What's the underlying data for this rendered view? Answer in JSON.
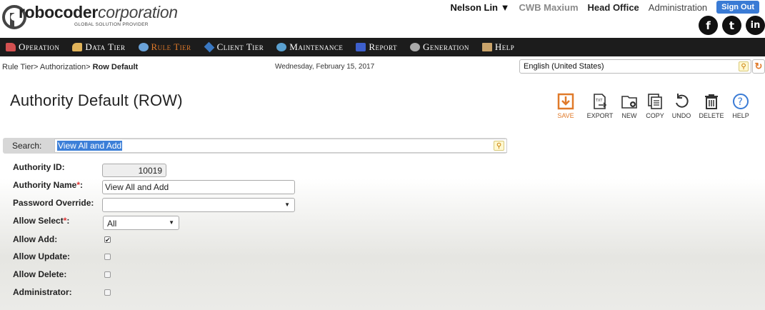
{
  "brand": {
    "name_bold": "robocoder",
    "name_italic": "corporation",
    "tagline": "GLOBAL SOLUTION PROVIDER"
  },
  "topnav": {
    "user": "Nelson Lin ▼",
    "company": "CWB Maxium",
    "office": "Head Office",
    "admin": "Administration",
    "signout": "Sign Out"
  },
  "social": {
    "facebook": "f",
    "twitter": "t",
    "linkedin": "in"
  },
  "menu": {
    "items": [
      {
        "label": "Operation",
        "icon": "operation-icon",
        "color": "#d35050"
      },
      {
        "label": "Data Tier",
        "icon": "data-tier-icon",
        "color": "#e0b35a"
      },
      {
        "label": "Rule Tier",
        "icon": "rule-tier-icon",
        "color": "#6aa2d8",
        "active": true
      },
      {
        "label": "Client Tier",
        "icon": "client-tier-icon",
        "color": "#3a78c2"
      },
      {
        "label": "Maintenance",
        "icon": "maintenance-icon",
        "color": "#5aa0d0"
      },
      {
        "label": "Report",
        "icon": "report-icon",
        "color": "#3d5fcc"
      },
      {
        "label": "Generation",
        "icon": "generation-icon",
        "color": "#aaaaaa"
      },
      {
        "label": "Help",
        "icon": "help-book-icon",
        "color": "#c9a36a"
      }
    ],
    "active_color": "#e07a2a"
  },
  "breadcrumb": {
    "part1": "Rule Tier>",
    "part2": " Authorization>",
    "current": " Row Default"
  },
  "date": "Wednesday, February 15, 2017",
  "language": {
    "selected": "English (United States)"
  },
  "page": {
    "title": "Authority Default (ROW)"
  },
  "toolbar": {
    "save": "SAVE",
    "export": "EXPORT",
    "new": "NEW",
    "copy": "COPY",
    "undo": "UNDO",
    "delete": "DELETE",
    "help": "HELP"
  },
  "search": {
    "label": "Search:",
    "value": "View All and Add"
  },
  "form": {
    "authority_id": {
      "label": "Authority ID:",
      "value": "10019"
    },
    "authority_name": {
      "label": "Authority Name",
      "required": "*",
      "colon": ":",
      "value": "View All and Add"
    },
    "password_override": {
      "label": "Password Override:",
      "value": ""
    },
    "allow_select": {
      "label": "Allow Select",
      "required": "*",
      "colon": ":",
      "value": "All"
    },
    "allow_add": {
      "label": "Allow Add:",
      "checked": true
    },
    "allow_update": {
      "label": "Allow Update:",
      "checked": false
    },
    "allow_delete": {
      "label": "Allow Delete:",
      "checked": false
    },
    "administrator": {
      "label": "Administrator:",
      "checked": false
    }
  }
}
